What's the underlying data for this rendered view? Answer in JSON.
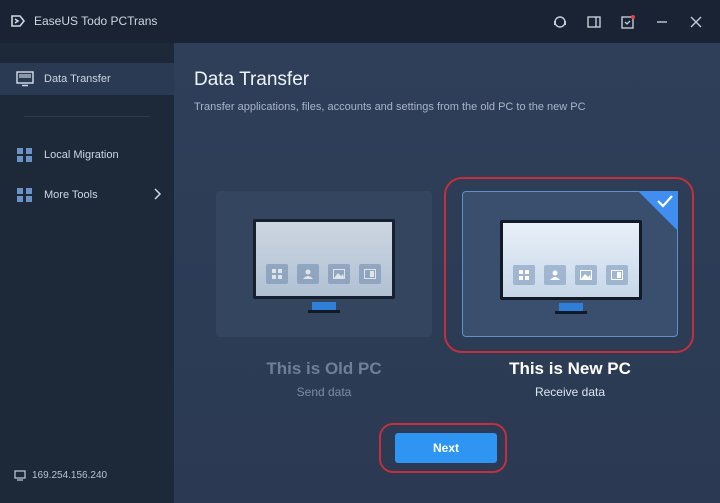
{
  "app": {
    "title": "EaseUS Todo PCTrans"
  },
  "titlebar_icons": [
    "support-icon",
    "feedback-icon",
    "notification-icon",
    "minimize-icon",
    "close-icon"
  ],
  "sidebar": {
    "items": [
      {
        "label": "Data Transfer",
        "icon": "monitor-icon",
        "active": true
      },
      {
        "label": "Local Migration",
        "icon": "grid-icon",
        "active": false
      },
      {
        "label": "More Tools",
        "icon": "grid-icon",
        "active": false
      }
    ],
    "ip_address": "169.254.156.240"
  },
  "main": {
    "title": "Data Transfer",
    "subtitle": "Transfer applications, files, accounts and settings from the old PC to the new PC",
    "cards": [
      {
        "title": "This is Old PC",
        "subtitle": "Send data",
        "selected": false
      },
      {
        "title": "This is New PC",
        "subtitle": "Receive data",
        "selected": true
      }
    ],
    "next_label": "Next"
  },
  "colors": {
    "accent": "#2f95f2",
    "highlight": "#c23040",
    "sidebar_bg": "#1d2839",
    "main_bg": "#2f3f59"
  }
}
